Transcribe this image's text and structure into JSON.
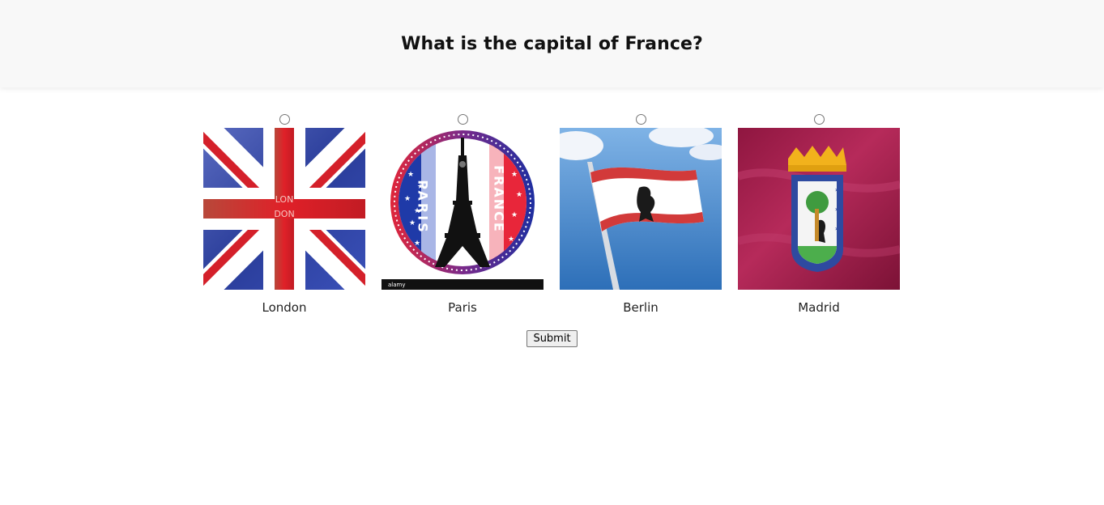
{
  "question": "What is the capital of France?",
  "options": [
    {
      "label": "London",
      "image": "union-jack-flag-icon",
      "selected": false
    },
    {
      "label": "Paris",
      "image": "paris-eiffel-tower-badge-icon",
      "selected": false
    },
    {
      "label": "Berlin",
      "image": "berlin-flag-icon",
      "selected": false
    },
    {
      "label": "Madrid",
      "image": "madrid-flag-icon",
      "selected": false
    }
  ],
  "paris_badge": {
    "left_text": "PARIS",
    "right_text": "FRANCE",
    "watermark": "alamy"
  },
  "london_overlay": [
    "LON",
    "DON"
  ],
  "submit_label": "Submit",
  "colors": {
    "header_bg": "#f8f8f8",
    "madrid_bg": "#9b1848",
    "union_blue": "#2b3f9c",
    "union_red": "#d4202a"
  }
}
